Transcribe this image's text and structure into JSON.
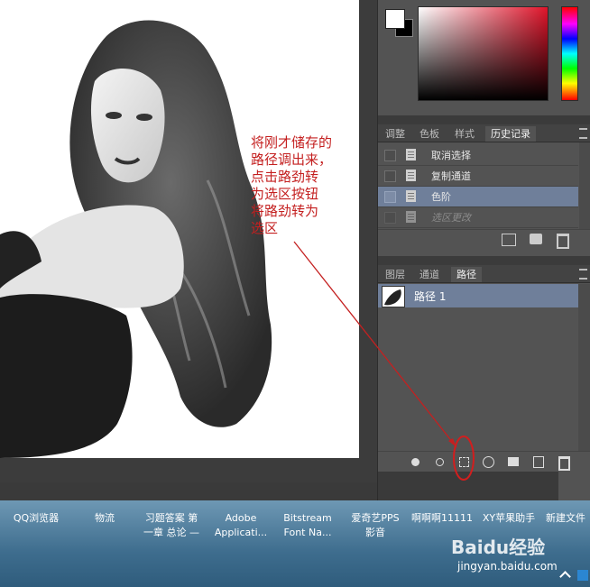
{
  "history_panel": {
    "tabs": [
      "调整",
      "色板",
      "样式",
      "历史记录"
    ],
    "items": [
      "取消选择",
      "复制通道",
      "色阶",
      "选区更改"
    ]
  },
  "paths_panel": {
    "tabs": [
      "图层",
      "通道",
      "路径"
    ],
    "path_name": "路径 1"
  },
  "annotation": [
    "将刚才储存的",
    "路径调出来，",
    "点击路劲转",
    "为选区按钮",
    "将路劲转为",
    "选区"
  ],
  "taskbar": {
    "items": [
      {
        "line1": "QQ浏览器",
        "line2": ""
      },
      {
        "line1": "物流",
        "line2": ""
      },
      {
        "line1": "习题答案 第",
        "line2": "一章 总论 —"
      },
      {
        "line1": "Adobe",
        "line2": "Applicati..."
      },
      {
        "line1": "Bitstream",
        "line2": "Font Na..."
      },
      {
        "line1": "爱奇艺PPS",
        "line2": "影音"
      },
      {
        "line1": "啊啊啊11111",
        "line2": ""
      },
      {
        "line1": "XY苹果助手",
        "line2": ""
      },
      {
        "line1": "新建文件",
        "line2": ""
      }
    ]
  },
  "watermark": {
    "brand": "Baidu经验",
    "url": "jingyan.baidu.com"
  },
  "colors": {
    "accent_red": "#c42020",
    "selected_row": "#6f7f9a"
  }
}
